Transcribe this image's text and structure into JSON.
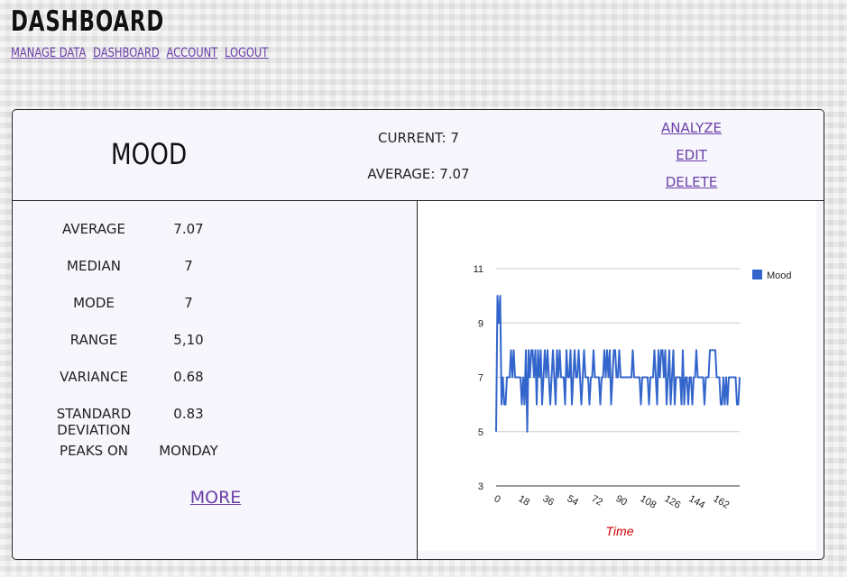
{
  "site": {
    "title": "DASHBOARD"
  },
  "nav": {
    "items": [
      "MANAGE DATA",
      "DASHBOARD",
      "ACCOUNT",
      "LOGOUT"
    ]
  },
  "metric": {
    "name": "MOOD",
    "current_label": "CURRENT:",
    "current_value": "7",
    "average_label": "AVERAGE:",
    "average_value": "7.07"
  },
  "actions": {
    "analyze": "ANALYZE",
    "edit": "EDIT",
    "delete": "DELETE"
  },
  "stats": [
    {
      "label": "AVERAGE",
      "value": "7.07"
    },
    {
      "label": "MEDIAN",
      "value": "7"
    },
    {
      "label": "MODE",
      "value": "7"
    },
    {
      "label": "RANGE",
      "value": "5,10"
    },
    {
      "label": "VARIANCE",
      "value": "0.68"
    },
    {
      "label": "STANDARD DEVIATION",
      "value": "0.83"
    },
    {
      "label": "PEAKS ON",
      "value": "MONDAY"
    }
  ],
  "more_label": "MORE",
  "colors": {
    "link": "#6b3fa8",
    "series": "#3366cc",
    "xlabel": "#cc0000"
  },
  "chart_data": {
    "type": "line",
    "xlabel": "Time",
    "ylabel": "",
    "ylim": [
      3,
      11
    ],
    "xlim": [
      0,
      180
    ],
    "yticks": [
      3,
      5,
      7,
      9,
      11
    ],
    "xticks": [
      0,
      18,
      36,
      54,
      72,
      90,
      108,
      126,
      144,
      162
    ],
    "grid": true,
    "legend": "right",
    "series": [
      {
        "name": "Mood",
        "values": [
          5,
          10,
          9,
          10,
          6,
          7,
          6,
          6,
          7,
          7,
          7,
          8,
          7,
          8,
          7,
          7,
          7,
          7,
          7,
          6,
          7,
          6,
          8,
          5,
          8,
          7,
          8,
          8,
          7,
          8,
          6,
          8,
          7,
          8,
          6,
          7,
          8,
          7,
          8,
          7,
          6,
          7,
          8,
          7,
          6,
          8,
          7,
          8,
          7,
          7,
          7,
          6,
          8,
          7,
          7,
          8,
          6,
          7,
          8,
          7,
          7,
          8,
          7,
          6,
          7,
          8,
          7,
          7,
          7,
          6,
          7,
          7,
          8,
          7,
          7,
          7,
          7,
          6,
          7,
          7,
          8,
          7,
          8,
          7,
          8,
          6,
          7,
          8,
          8,
          7,
          7,
          8,
          7,
          7,
          7,
          7,
          7,
          7,
          7,
          7,
          7,
          8,
          7,
          7,
          7,
          7,
          7,
          6,
          7,
          7,
          7,
          7,
          7,
          6,
          7,
          7,
          7,
          8,
          7,
          6,
          8,
          7,
          8,
          8,
          7,
          8,
          6,
          7,
          8,
          6,
          7,
          8,
          6,
          7,
          7,
          7,
          7,
          6,
          8,
          6,
          7,
          7,
          6,
          7,
          7,
          6,
          7,
          7,
          8,
          7,
          7,
          7,
          7,
          7,
          6,
          7,
          7,
          7,
          8,
          8,
          8,
          8,
          8,
          7,
          7,
          7,
          6,
          6,
          7,
          6,
          7,
          6,
          7,
          7,
          7,
          7,
          7,
          7,
          6,
          6,
          7
        ]
      }
    ]
  }
}
